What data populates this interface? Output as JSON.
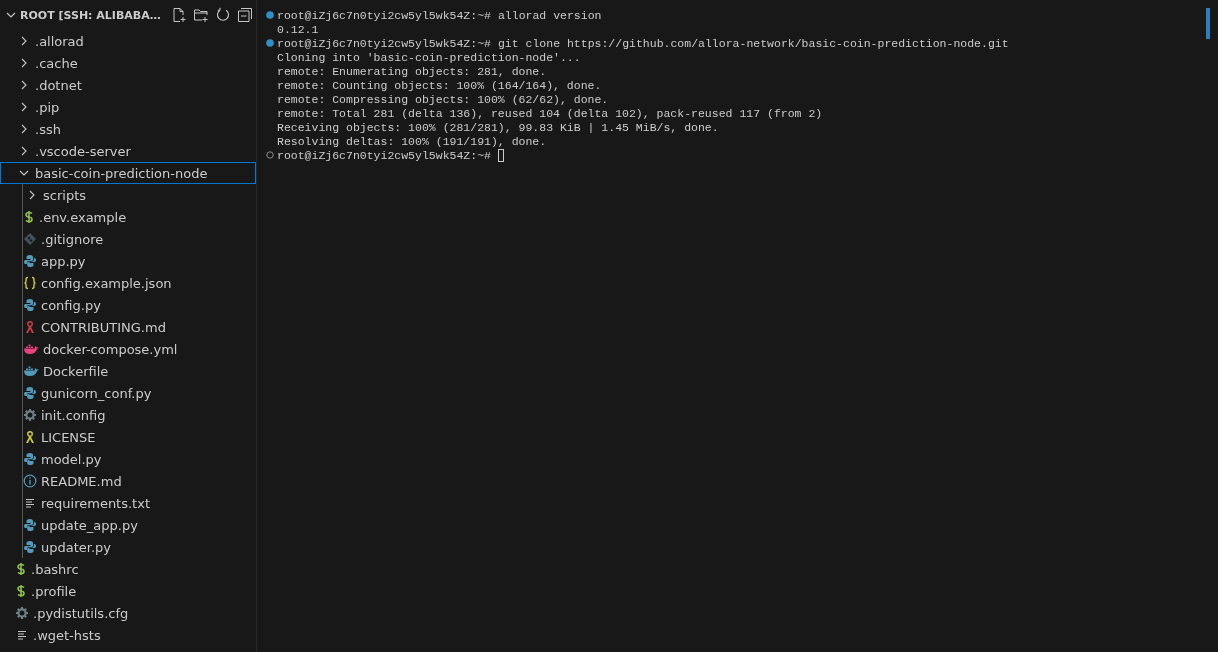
{
  "explorer": {
    "title": "ROOT [SSH: ALIBABA…",
    "expanded": true,
    "tree": [
      {
        "name": ".allorad",
        "kind": "folder",
        "expanded": false,
        "selected": false
      },
      {
        "name": ".cache",
        "kind": "folder",
        "expanded": false,
        "selected": false
      },
      {
        "name": ".dotnet",
        "kind": "folder",
        "expanded": false,
        "selected": false
      },
      {
        "name": ".pip",
        "kind": "folder",
        "expanded": false,
        "selected": false
      },
      {
        "name": ".ssh",
        "kind": "folder",
        "expanded": false,
        "selected": false
      },
      {
        "name": ".vscode-server",
        "kind": "folder",
        "expanded": false,
        "selected": false
      },
      {
        "name": "basic-coin-prediction-node",
        "kind": "folder",
        "expanded": true,
        "selected": true,
        "children": [
          {
            "name": "scripts",
            "kind": "folder",
            "expanded": false,
            "selected": false
          },
          {
            "name": ".env.example",
            "kind": "shell",
            "selected": false
          },
          {
            "name": ".gitignore",
            "kind": "git",
            "selected": false
          },
          {
            "name": "app.py",
            "kind": "python",
            "selected": false
          },
          {
            "name": "config.example.json",
            "kind": "json",
            "selected": false
          },
          {
            "name": "config.py",
            "kind": "python",
            "selected": false
          },
          {
            "name": "CONTRIBUTING.md",
            "kind": "ribbon",
            "selected": false
          },
          {
            "name": "docker-compose.yml",
            "kind": "compose",
            "selected": false
          },
          {
            "name": "Dockerfile",
            "kind": "docker",
            "selected": false
          },
          {
            "name": "gunicorn_conf.py",
            "kind": "python",
            "selected": false
          },
          {
            "name": "init.config",
            "kind": "gear",
            "selected": false
          },
          {
            "name": "LICENSE",
            "kind": "license",
            "selected": false
          },
          {
            "name": "model.py",
            "kind": "python",
            "selected": false
          },
          {
            "name": "README.md",
            "kind": "info",
            "selected": false
          },
          {
            "name": "requirements.txt",
            "kind": "text",
            "selected": false
          },
          {
            "name": "update_app.py",
            "kind": "python",
            "selected": false
          },
          {
            "name": "updater.py",
            "kind": "python",
            "selected": false
          }
        ]
      },
      {
        "name": ".bashrc",
        "kind": "shell",
        "selected": false
      },
      {
        "name": ".profile",
        "kind": "shell",
        "selected": false
      },
      {
        "name": ".pydistutils.cfg",
        "kind": "gear",
        "selected": false
      },
      {
        "name": ".wget-hsts",
        "kind": "text",
        "selected": false
      }
    ]
  },
  "terminal": {
    "lines": [
      {
        "kind": "prompt",
        "done": true,
        "prompt": "root@iZj6c7n0tyi2cw5yl5wk54Z:~#",
        "command": "allorad version",
        "cursor": false
      },
      {
        "kind": "output",
        "text": "0.12.1"
      },
      {
        "kind": "prompt",
        "done": true,
        "prompt": "root@iZj6c7n0tyi2cw5yl5wk54Z:~#",
        "command": "git clone https://github.com/allora-network/basic-coin-prediction-node.git",
        "cursor": false
      },
      {
        "kind": "output",
        "text": "Cloning into 'basic-coin-prediction-node'..."
      },
      {
        "kind": "output",
        "text": "remote: Enumerating objects: 281, done."
      },
      {
        "kind": "output",
        "text": "remote: Counting objects: 100% (164/164), done."
      },
      {
        "kind": "output",
        "text": "remote: Compressing objects: 100% (62/62), done."
      },
      {
        "kind": "output",
        "text": "remote: Total 281 (delta 136), reused 104 (delta 102), pack-reused 117 (from 2)"
      },
      {
        "kind": "output",
        "text": "Receiving objects: 100% (281/281), 99.83 KiB | 1.45 MiB/s, done."
      },
      {
        "kind": "output",
        "text": "Resolving deltas: 100% (191/191), done."
      },
      {
        "kind": "prompt",
        "done": false,
        "prompt": "root@iZj6c7n0tyi2cw5yl5wk54Z:~#",
        "cursor": true
      }
    ]
  }
}
